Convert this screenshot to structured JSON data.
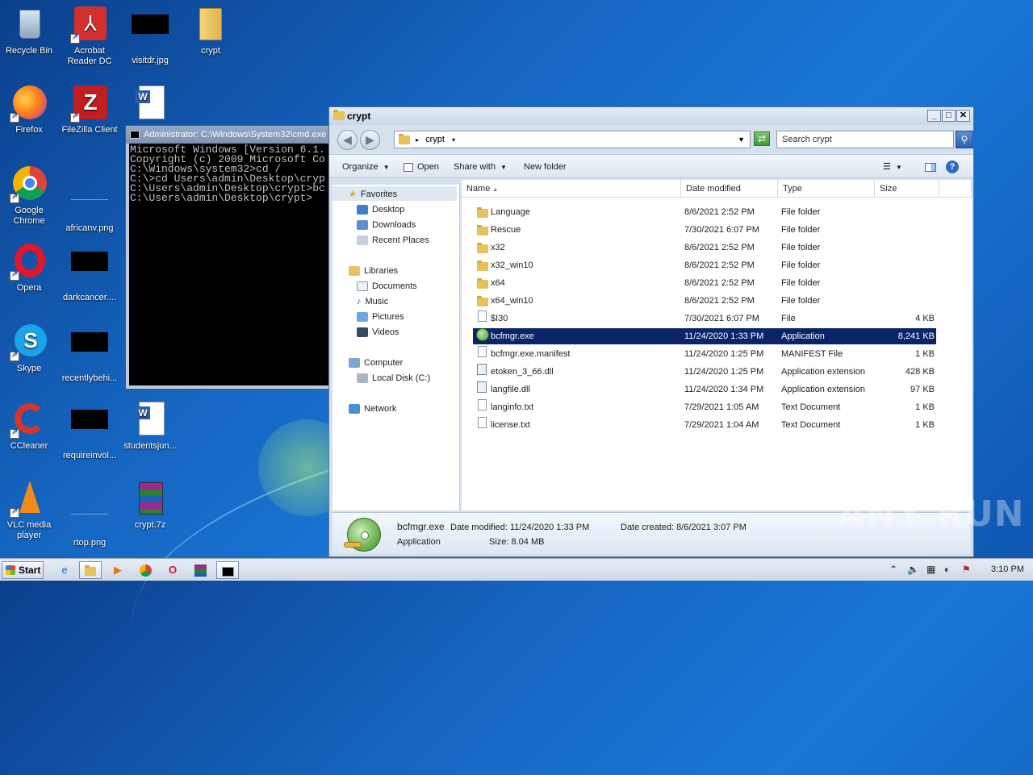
{
  "desktop": {
    "icons": [
      {
        "id": "recycle",
        "label": "Recycle Bin"
      },
      {
        "id": "acrobat",
        "label": "Acrobat Reader DC"
      },
      {
        "id": "visitdr",
        "label": "visitdr.jpg"
      },
      {
        "id": "crypt",
        "label": "crypt"
      },
      {
        "id": "firefox",
        "label": "Firefox"
      },
      {
        "id": "filezilla",
        "label": "FileZilla Client"
      },
      {
        "id": "chrome",
        "label": "Google Chrome"
      },
      {
        "id": "africanv",
        "label": "africanv.png"
      },
      {
        "id": "opera",
        "label": "Opera"
      },
      {
        "id": "darkcancer",
        "label": "darkcancer...."
      },
      {
        "id": "skype",
        "label": "Skype"
      },
      {
        "id": "recentlybeh",
        "label": "recentlybehi..."
      },
      {
        "id": "ccleaner",
        "label": "CCleaner"
      },
      {
        "id": "requireinvol",
        "label": "requireinvol..."
      },
      {
        "id": "studentsjun",
        "label": "studentsjun..."
      },
      {
        "id": "vlc",
        "label": "VLC media player"
      },
      {
        "id": "rtop",
        "label": "rtop.png"
      },
      {
        "id": "crypt7z",
        "label": "crypt.7z"
      }
    ]
  },
  "cmd": {
    "title": "Administrator: C:\\Windows\\System32\\cmd.exe",
    "lines": [
      "Microsoft Windows [Version 6.1.",
      "Copyright (c) 2009 Microsoft Co",
      "",
      "C:\\Windows\\system32>cd /",
      "",
      "C:\\>cd Users\\admin\\Desktop\\cryp",
      "",
      "C:\\Users\\admin\\Desktop\\crypt>bc",
      "",
      "C:\\Users\\admin\\Desktop\\crypt>"
    ]
  },
  "explorer": {
    "title": "crypt",
    "address": "crypt",
    "search_placeholder": "Search crypt",
    "toolbar": {
      "organize": "Organize",
      "open": "Open",
      "share_with": "Share with",
      "new_folder": "New folder"
    },
    "nav": {
      "favorites": "Favorites",
      "desktop": "Desktop",
      "downloads": "Downloads",
      "recent": "Recent Places",
      "libraries": "Libraries",
      "documents": "Documents",
      "music": "Music",
      "pictures": "Pictures",
      "videos": "Videos",
      "computer": "Computer",
      "local_disk": "Local Disk (C:)",
      "network": "Network"
    },
    "columns": {
      "name": "Name",
      "date": "Date modified",
      "type": "Type",
      "size": "Size"
    },
    "files": [
      {
        "name": "Language",
        "date": "8/6/2021 2:52 PM",
        "type": "File folder",
        "size": "",
        "kind": "folder"
      },
      {
        "name": "Rescue",
        "date": "7/30/2021 6:07 PM",
        "type": "File folder",
        "size": "",
        "kind": "folder"
      },
      {
        "name": "x32",
        "date": "8/6/2021 2:52 PM",
        "type": "File folder",
        "size": "",
        "kind": "folder"
      },
      {
        "name": "x32_win10",
        "date": "8/6/2021 2:52 PM",
        "type": "File folder",
        "size": "",
        "kind": "folder"
      },
      {
        "name": "x64",
        "date": "8/6/2021 2:52 PM",
        "type": "File folder",
        "size": "",
        "kind": "folder"
      },
      {
        "name": "x64_win10",
        "date": "8/6/2021 2:52 PM",
        "type": "File folder",
        "size": "",
        "kind": "folder"
      },
      {
        "name": "$I30",
        "date": "7/30/2021 6:07 PM",
        "type": "File",
        "size": "4 KB",
        "kind": "file"
      },
      {
        "name": "bcfmgr.exe",
        "date": "11/24/2020 1:33 PM",
        "type": "Application",
        "size": "8,241 KB",
        "kind": "exe"
      },
      {
        "name": "bcfmgr.exe.manifest",
        "date": "11/24/2020 1:25 PM",
        "type": "MANIFEST File",
        "size": "1 KB",
        "kind": "file"
      },
      {
        "name": "etoken_3_66.dll",
        "date": "11/24/2020 1:25 PM",
        "type": "Application extension",
        "size": "428 KB",
        "kind": "dll"
      },
      {
        "name": "langfile.dll",
        "date": "11/24/2020 1:34 PM",
        "type": "Application extension",
        "size": "97 KB",
        "kind": "dll"
      },
      {
        "name": "langinfo.txt",
        "date": "7/29/2021 1:05 AM",
        "type": "Text Document",
        "size": "1 KB",
        "kind": "file"
      },
      {
        "name": "license.txt",
        "date": "7/29/2021 1:04 AM",
        "type": "Text Document",
        "size": "1 KB",
        "kind": "file"
      }
    ],
    "details": {
      "name": "bcfmgr.exe",
      "date_modified": "Date modified: 11/24/2020 1:33 PM",
      "date_created": "Date created: 8/6/2021 3:07 PM",
      "type": "Application",
      "size": "Size: 8.04 MB"
    }
  },
  "taskbar": {
    "start": "Start",
    "clock": "3:10 PM"
  },
  "watermark": "ANY RUN"
}
